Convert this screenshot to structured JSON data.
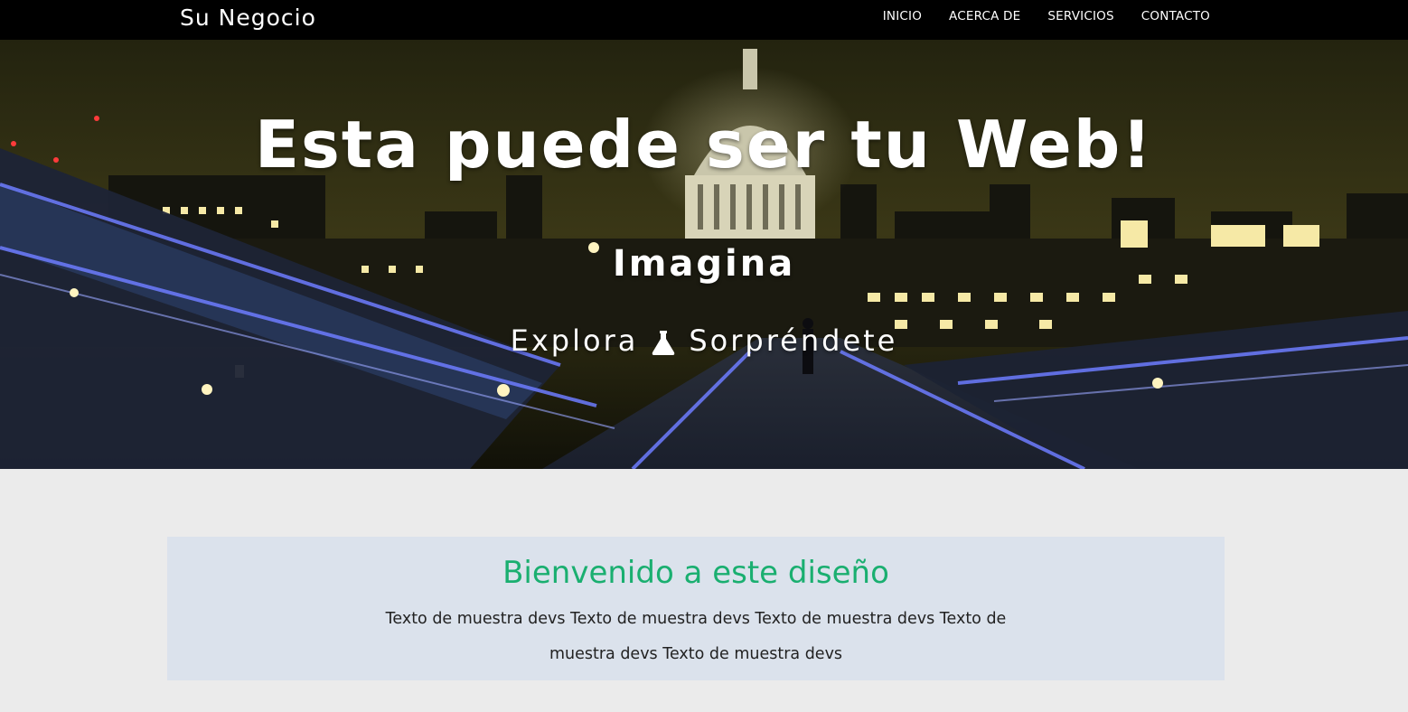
{
  "navbar": {
    "brand": "Su Negocio",
    "links": [
      "INICIO",
      "ACERCA DE",
      "SERVICIOS",
      "CONTACTO"
    ]
  },
  "hero": {
    "title": "Esta puede ser tu Web!",
    "subtitle": "Imagina",
    "tagline_left": "Explora",
    "tagline_icon": "flask-icon",
    "tagline_right": "Sorpréndete"
  },
  "welcome": {
    "title": "Bienvenido a este diseño",
    "text": "Texto de muestra devs Texto de muestra devs Texto de muestra devs Texto de muestra devs Texto de muestra devs"
  },
  "colors": {
    "navbar_bg": "#000000",
    "page_bg": "#ebebeb",
    "welcome_bg": "#dbe2ec",
    "accent": "#1aaf70"
  }
}
